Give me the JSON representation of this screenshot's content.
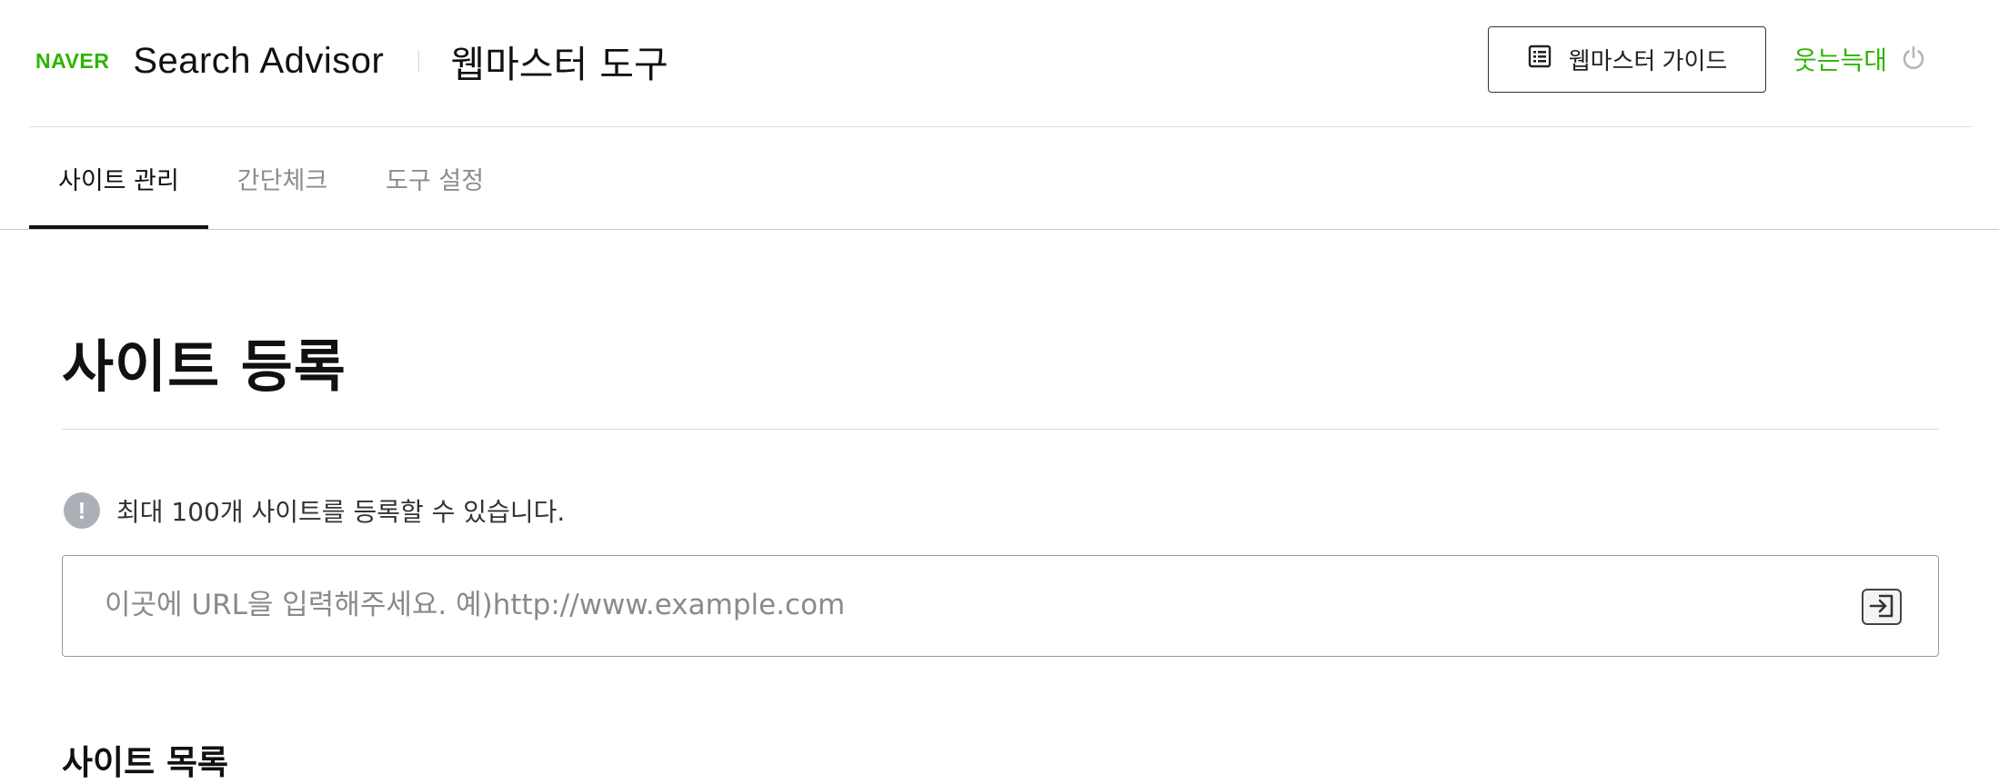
{
  "header": {
    "logo_text": "NAVER",
    "title": "Search Advisor",
    "subtitle": "웹마스터 도구",
    "guide_button_label": "웹마스터 가이드",
    "user_name": "웃는늑대",
    "icons": {
      "guide": "list-icon",
      "logout": "power-icon"
    },
    "colors": {
      "brand": "#2db400"
    }
  },
  "tabs": [
    {
      "label": "사이트 관리",
      "active": true
    },
    {
      "label": "간단체크",
      "active": false
    },
    {
      "label": "도구 설정",
      "active": false
    }
  ],
  "main": {
    "page_title": "사이트 등록",
    "notice_text": "최대 100개 사이트를 등록할 수 있습니다.",
    "notice_icon": "exclamation-icon",
    "url_input": {
      "value": "",
      "placeholder": "이곳에 URL을 입력해주세요. 예)http://www.example.com"
    },
    "submit_icon": "submit-arrow-icon",
    "site_list_title": "사이트 목록"
  }
}
